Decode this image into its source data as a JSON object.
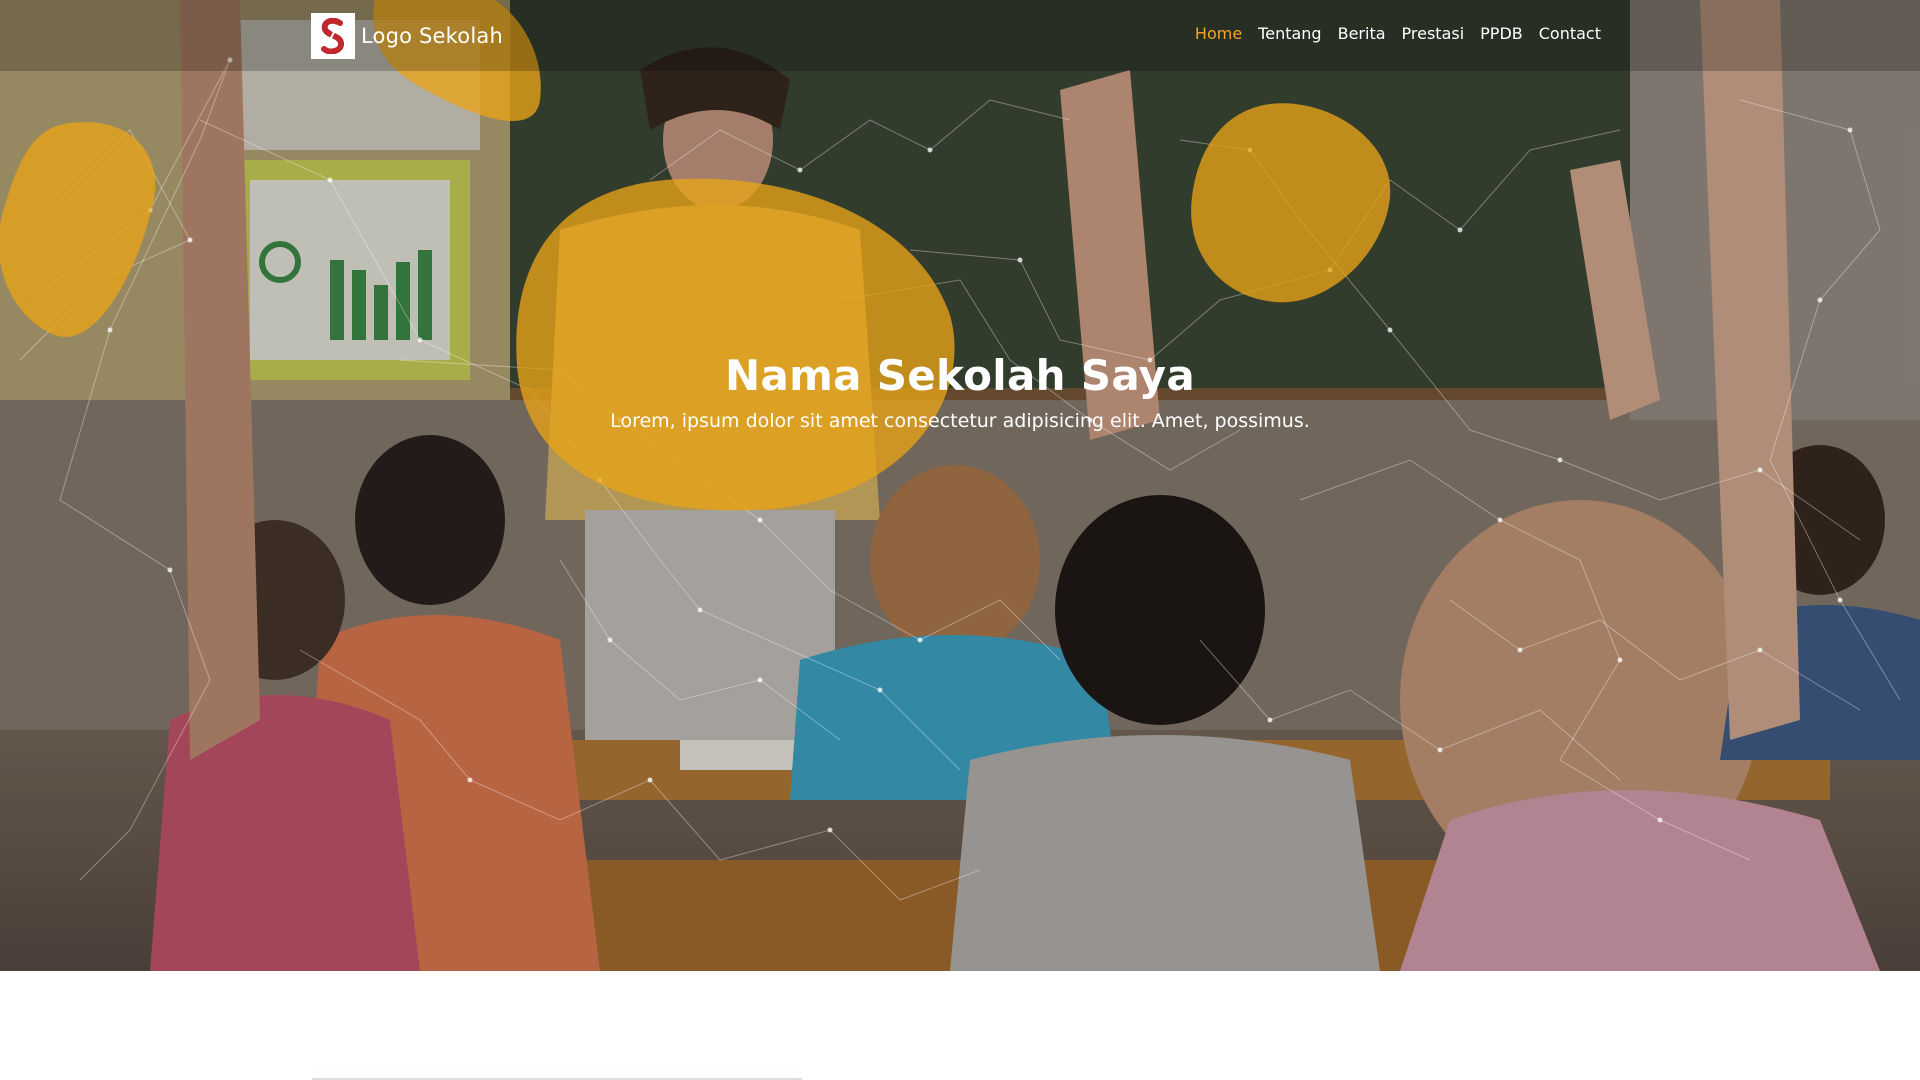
{
  "brand": {
    "logo_letter": "S",
    "name": "Logo Sekolah"
  },
  "nav": {
    "items": [
      {
        "label": "Home",
        "active": true
      },
      {
        "label": "Tentang",
        "active": false
      },
      {
        "label": "Berita",
        "active": false
      },
      {
        "label": "Prestasi",
        "active": false
      },
      {
        "label": "PPDB",
        "active": false
      },
      {
        "label": "Contact",
        "active": false
      }
    ]
  },
  "hero": {
    "title": "Nama Sekolah Saya",
    "subtitle": "Lorem, ipsum dolor sit amet consectetur adipisicing elit. Amet, possimus."
  },
  "colors": {
    "accent": "#f5a623",
    "blob": "#e8a317",
    "logo_red": "#c0282d"
  }
}
